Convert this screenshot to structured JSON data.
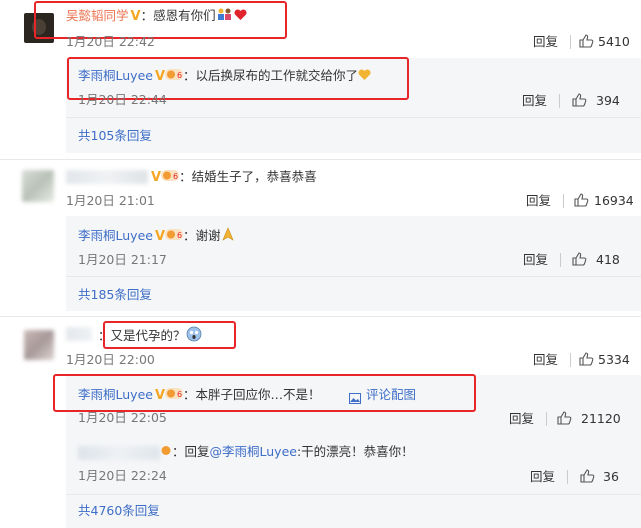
{
  "c1": {
    "user": "吴懿韬同学",
    "text": "：感恩有你们",
    "time": "1月20日 22:42",
    "reply": "回复",
    "likes": "5410",
    "sub": {
      "user": "李雨桐Luyee",
      "text": "：以后换尿布的工作就交给你了",
      "time": "1月20日 22:44",
      "reply": "回复",
      "likes": "394"
    },
    "more": "共105条回复"
  },
  "c2": {
    "text": "：结婚生子了，恭喜恭喜",
    "time": "1月20日 21:01",
    "reply": "回复",
    "likes": "16934",
    "sub": {
      "user": "李雨桐Luyee",
      "text": "：谢谢",
      "time": "1月20日 21:17",
      "reply": "回复",
      "likes": "418"
    },
    "more": "共185条回复"
  },
  "c3": {
    "text": "：又是代孕的？",
    "time": "1月20日 22:00",
    "reply": "回复",
    "likes": "5334",
    "sub": {
      "user": "李雨桐Luyee",
      "text": "：本胖子回应你…不是！",
      "pic_link": "评论配图",
      "time": "1月20日 22:05",
      "reply": "回复",
      "likes": "21120"
    },
    "sub2": {
      "text": "：回复",
      "mention": "@李雨桐Luyee",
      "text2": ":干的漂亮！恭喜你！",
      "time": "1月20日 22:24",
      "reply": "回复",
      "likes": "36"
    },
    "more": "共4760条回复"
  },
  "colors": {
    "accent_red": "#e8262a",
    "name_orange": "#eb7350",
    "link_blue": "#3e6ec7"
  }
}
